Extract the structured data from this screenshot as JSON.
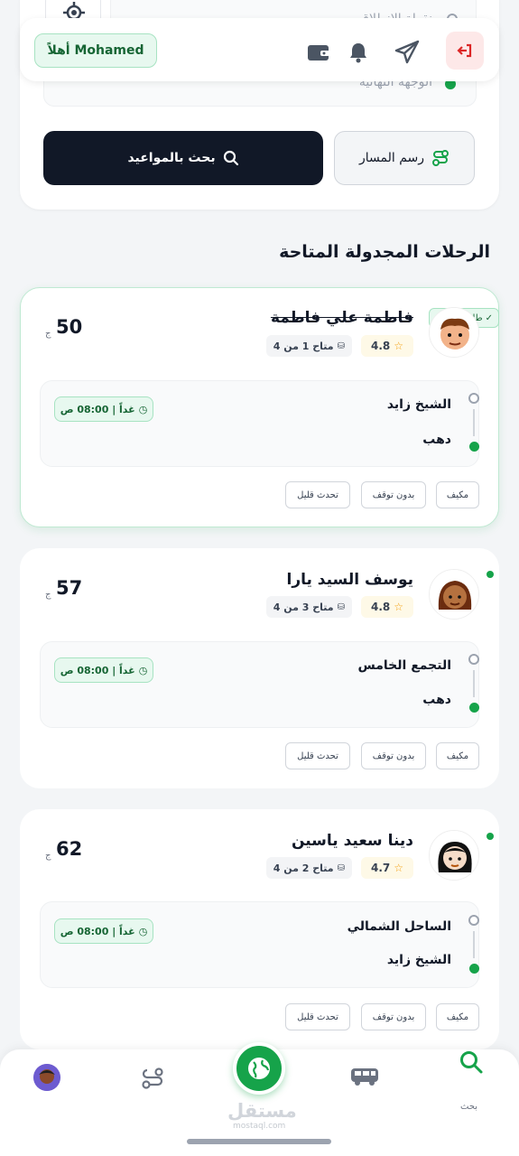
{
  "search": {
    "start_placeholder": "نقطة الانطلاق",
    "dest_placeholder": "الوجهة النهائية",
    "search_btn": "بحث بالمواعيد",
    "route_btn": "رسم المسار"
  },
  "header": {
    "greeting": "أهلاً Mohamed"
  },
  "section_title": "الرحلات المجدولة المتاحة",
  "trips": [
    {
      "badge": "طلبي الحالي",
      "driver": "فاطمة علي فاطمة",
      "rating": "4.8",
      "seats": "متاح 1 من 4",
      "price": "50",
      "currency": "ج",
      "from": "الشيخ زايد",
      "to": "دهب",
      "time": "غداً | 08:00 ص",
      "tags": [
        "مكيف",
        "بدون توقف",
        "تحدث قليل"
      ]
    },
    {
      "driver": "يوسف السيد يارا",
      "rating": "4.8",
      "seats": "متاح 3 من 4",
      "price": "57",
      "currency": "ج",
      "from": "التجمع الخامس",
      "to": "دهب",
      "time": "غداً | 08:00 ص",
      "tags": [
        "مكيف",
        "بدون توقف",
        "تحدث قليل"
      ]
    },
    {
      "driver": "دينا سعيد ياسين",
      "rating": "4.7",
      "seats": "متاح 2 من 4",
      "price": "62",
      "currency": "ج",
      "from": "الساحل الشمالي",
      "to": "الشيخ زايد",
      "time": "غداً | 08:00 ص",
      "tags": [
        "مكيف",
        "بدون توقف",
        "تحدث قليل"
      ]
    }
  ],
  "nav": {
    "search_label": "بحث",
    "watermark": "مستقل",
    "watermark_sub": "mostaql.com"
  },
  "colors": {
    "accent": "#16a34a",
    "dark": "#111827",
    "danger": "#dc2626"
  }
}
